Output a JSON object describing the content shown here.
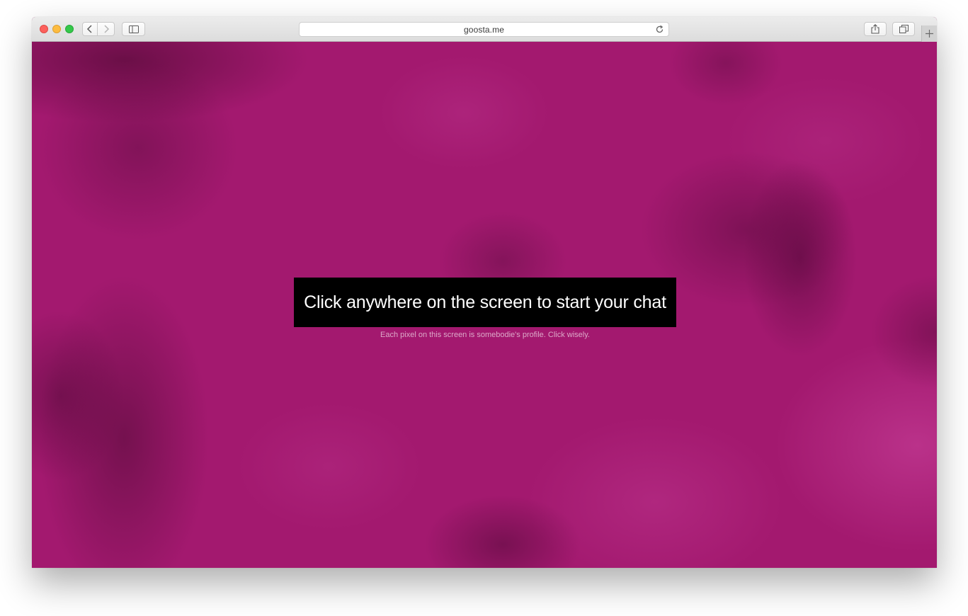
{
  "browser": {
    "url": "goosta.me",
    "icons": {
      "back": "chevron-left-icon",
      "forward": "chevron-right-icon",
      "sidebar": "sidebar-icon",
      "reload": "reload-icon",
      "share": "share-icon",
      "tabs": "tabs-overview-icon",
      "new_tab": "plus-icon"
    }
  },
  "page": {
    "cta_text": "Click anywhere on the screen to start your chat",
    "hint_text": "Each pixel on this screen is somebodie's profile. Click wisely.",
    "colors": {
      "background": "#a3196f",
      "cta_box": "#000000",
      "cta_text": "#ffffff"
    }
  }
}
